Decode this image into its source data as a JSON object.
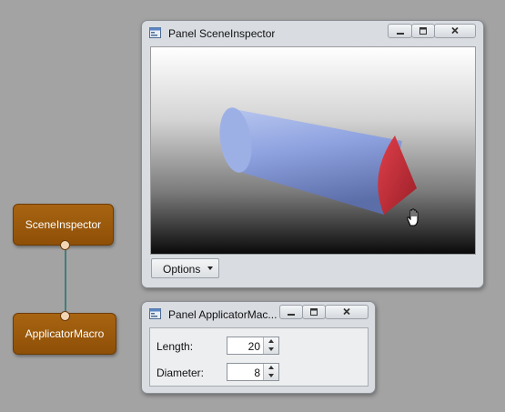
{
  "network": {
    "nodes": [
      {
        "label": "SceneInspector"
      },
      {
        "label": "ApplicatorMacro"
      }
    ],
    "node_color": "#9a5a0c",
    "connection_color": "#3f7f7c"
  },
  "scene_panel": {
    "title": "Panel SceneInspector",
    "icons": {
      "app": "panel-app-icon",
      "minimize": "minimize-icon",
      "maximize": "maximize-icon",
      "close": "close-icon",
      "cursor": "hand-cursor-icon"
    },
    "viewer": {
      "object": "cone-cylinder",
      "cylinder_color": "#8ea2e0",
      "cone_color": "#c8303a"
    },
    "options_label": "Options"
  },
  "applicator_panel": {
    "title": "Panel ApplicatorMac...",
    "fields": [
      {
        "label": "Length:",
        "value": "20"
      },
      {
        "label": "Diameter:",
        "value": "8"
      }
    ]
  }
}
